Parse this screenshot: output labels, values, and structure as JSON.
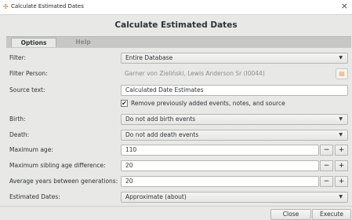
{
  "window": {
    "title": "Calculate Estimated Dates",
    "close_glyph": "×"
  },
  "dialog": {
    "heading": "Calculate Estimated Dates"
  },
  "tabs": [
    {
      "label": "Options",
      "active": true
    },
    {
      "label": "Help",
      "active": false
    }
  ],
  "options": {
    "filter": {
      "label": "Filter:",
      "value": "Entire Database"
    },
    "filter_person": {
      "label": "Filter Person:",
      "value": "Garner von Zieliński, Lewis Anderson Sr (I0044)"
    },
    "source_text": {
      "label": "Source text:",
      "value": "Calculated Date Estimates"
    },
    "remove_previous": {
      "label": "Remove previously added events, notes, and source",
      "checked": true
    },
    "birth": {
      "label": "Birth:",
      "value": "Do not add birth events"
    },
    "death": {
      "label": "Death:",
      "value": "Do not add death events"
    },
    "max_age": {
      "label": "Maximum age:",
      "value": "110"
    },
    "max_sibling_diff": {
      "label": "Maximum sibling age difference:",
      "value": "20"
    },
    "avg_years_gen": {
      "label": "Average years between generations:",
      "value": "20"
    },
    "estimated_dates": {
      "label": "Estimated Dates:",
      "value": "Approximate (about)"
    }
  },
  "spin": {
    "minus": "−",
    "plus": "+"
  },
  "buttons": {
    "close": "Close",
    "execute": "Execute"
  },
  "icons": {
    "app": "gramps-icon",
    "person_select": "person-select-icon"
  }
}
